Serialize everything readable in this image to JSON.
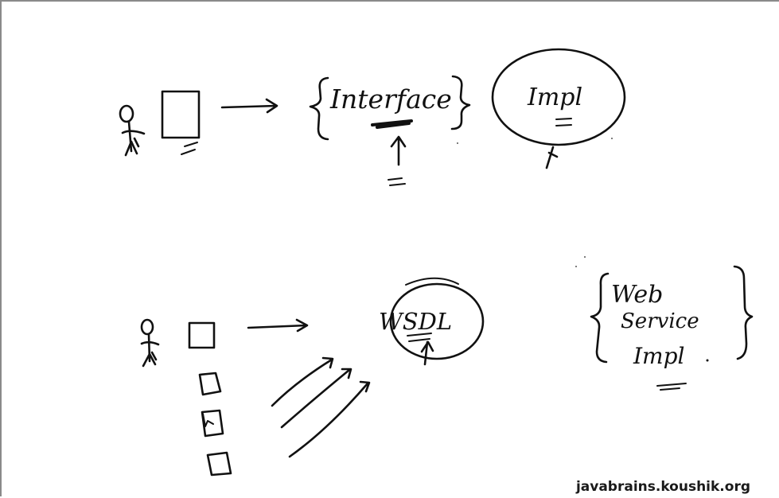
{
  "labels": {
    "interface": "Interface",
    "impl": "Impl",
    "wsdl": "WSDL",
    "web_service_impl_line1": "Web",
    "web_service_impl_line2": "Service",
    "web_service_impl_line3": "Impl"
  },
  "watermark": "javabrains.koushik.org"
}
